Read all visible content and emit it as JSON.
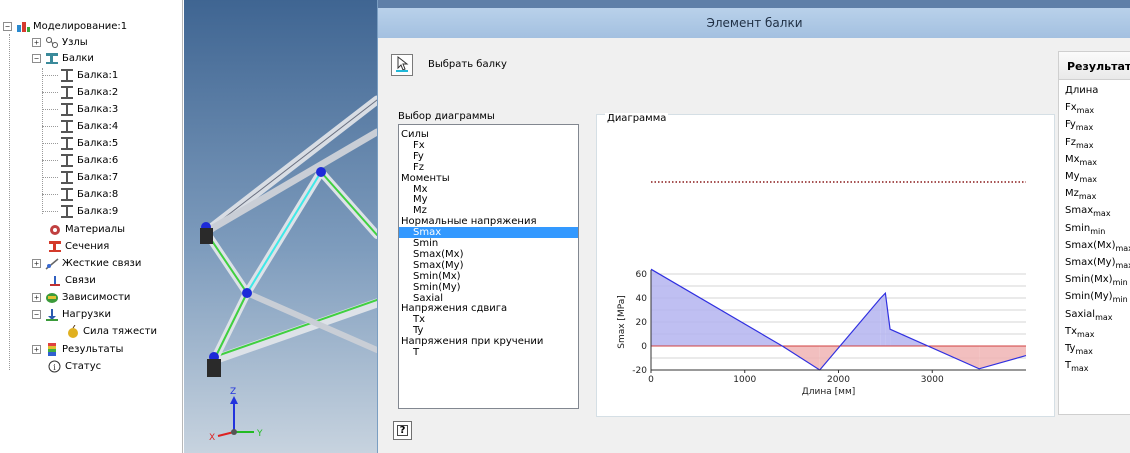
{
  "tree": {
    "root": "Моделирование:1",
    "nodes": "Узлы",
    "beams": "Балки",
    "beam_items": [
      "Балка:1",
      "Балка:2",
      "Балка:3",
      "Балка:4",
      "Балка:5",
      "Балка:6",
      "Балка:7",
      "Балка:8",
      "Балка:9"
    ],
    "materials": "Материалы",
    "sections": "Сечения",
    "rigid_links": "Жесткие связи",
    "constraints": "Связи",
    "dependencies": "Зависимости",
    "loads": "Нагрузки",
    "gravity": "Сила тяжести",
    "results": "Результаты",
    "status": "Статус"
  },
  "dialog": {
    "title": "Элемент балки",
    "pick_label": "Выбрать балку",
    "diagram_select_label": "Выбор диаграммы",
    "diagram_label": "Диаграмма",
    "list": [
      {
        "label": "Силы",
        "sub": false
      },
      {
        "label": "Fx",
        "sub": true
      },
      {
        "label": "Fy",
        "sub": true
      },
      {
        "label": "Fz",
        "sub": true
      },
      {
        "label": "Моменты",
        "sub": false
      },
      {
        "label": "Mx",
        "sub": true
      },
      {
        "label": "My",
        "sub": true
      },
      {
        "label": "Mz",
        "sub": true
      },
      {
        "label": "Нормальные напряжения",
        "sub": false
      },
      {
        "label": "Smax",
        "sub": true,
        "selected": true
      },
      {
        "label": "Smin",
        "sub": true
      },
      {
        "label": "Smax(Mx)",
        "sub": true
      },
      {
        "label": "Smax(My)",
        "sub": true
      },
      {
        "label": "Smin(Mx)",
        "sub": true
      },
      {
        "label": "Smin(My)",
        "sub": true
      },
      {
        "label": "Saxial",
        "sub": true
      },
      {
        "label": "Напряжения сдвига",
        "sub": false
      },
      {
        "label": "Tx",
        "sub": true
      },
      {
        "label": "Ty",
        "sub": true
      },
      {
        "label": "Напряжения при кручении",
        "sub": false
      },
      {
        "label": "T",
        "sub": true
      }
    ],
    "results_header": "Результаты",
    "results": [
      {
        "base": "Длина",
        "sub": ""
      },
      {
        "base": "Fx",
        "sub": "max"
      },
      {
        "base": "Fy",
        "sub": "max"
      },
      {
        "base": "Fz",
        "sub": "max"
      },
      {
        "base": "Mx",
        "sub": "max"
      },
      {
        "base": "My",
        "sub": "max"
      },
      {
        "base": "Mz",
        "sub": "max"
      },
      {
        "base": "Smax",
        "sub": "max"
      },
      {
        "base": "Smin",
        "sub": "min"
      },
      {
        "base": "Smax(Mx)",
        "sub": "max"
      },
      {
        "base": "Smax(My)",
        "sub": "max"
      },
      {
        "base": "Smin(Mx)",
        "sub": "min"
      },
      {
        "base": "Smin(My)",
        "sub": "min"
      },
      {
        "base": "Saxial",
        "sub": "max"
      },
      {
        "base": "Tx",
        "sub": "max"
      },
      {
        "base": "Ty",
        "sub": "max"
      },
      {
        "base": "T",
        "sub": "max"
      }
    ],
    "help": "?"
  },
  "viewport": {
    "axis_z": "Z",
    "axis_x": "X",
    "axis_y": "Y"
  },
  "chart_data": {
    "type": "area",
    "xlabel": "Длина [мм]",
    "ylabel": "Smax [MPa]",
    "xlim": [
      0,
      4000
    ],
    "ylim": [
      -20,
      60
    ],
    "xticks": [
      0,
      1000,
      2000,
      3000
    ],
    "yticks": [
      60,
      40,
      20,
      0,
      -20
    ],
    "x": [
      0,
      1400,
      1800,
      2450,
      2500,
      2550,
      3500,
      4000
    ],
    "y": [
      64,
      0,
      -20,
      40,
      44,
      14,
      -19,
      -8
    ],
    "positive_color": "#b4b4f0",
    "negative_color": "#f0b4b4",
    "line_color": "#3030e0",
    "grid": true
  }
}
